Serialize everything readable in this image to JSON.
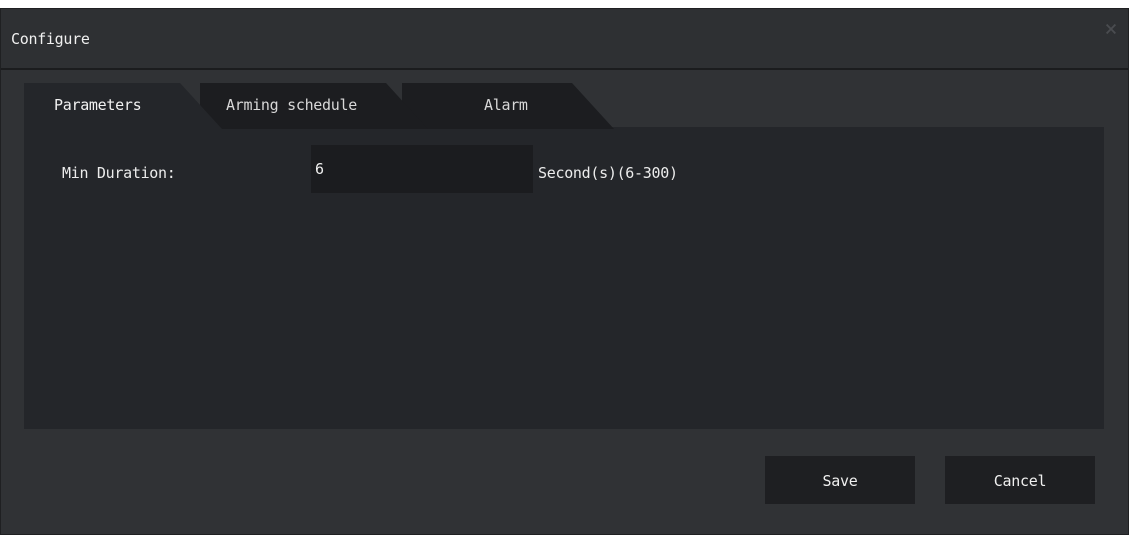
{
  "dialog": {
    "title": "Configure",
    "close_label": "×"
  },
  "tabs": [
    {
      "label": "Parameters",
      "active": true
    },
    {
      "label": "Arming schedule",
      "active": false
    },
    {
      "label": "Alarm",
      "active": false
    }
  ],
  "parameters": {
    "min_duration_label": "Min Duration:",
    "min_duration_value": "6",
    "min_duration_unit": "Second(s)(6-300)"
  },
  "footer": {
    "save_label": "Save",
    "cancel_label": "Cancel"
  },
  "colors": {
    "dialog_bg": "#303235",
    "content_bg": "#24262a",
    "tab_active": "#24262a",
    "tab_inactive": "#1c1d20",
    "button_bg": "#1e1f22"
  }
}
